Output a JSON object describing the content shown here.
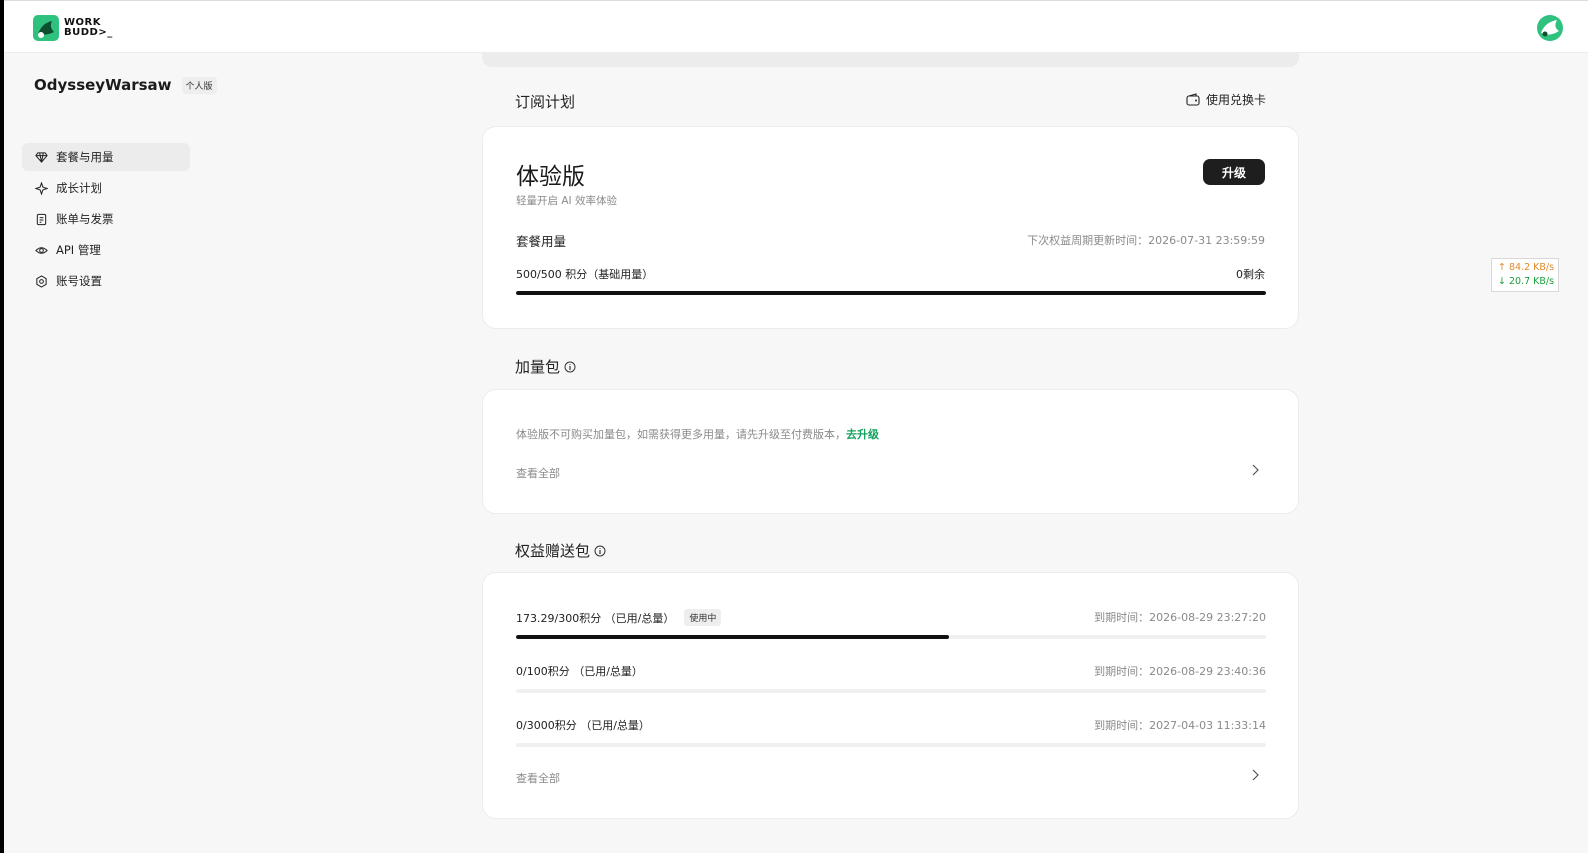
{
  "app": {
    "logo_text_line1": "WORK",
    "logo_text_line2": "BUDD>_"
  },
  "profile": {
    "name": "OdysseyWarsaw",
    "badge": "个人版"
  },
  "sidebar": {
    "items": [
      {
        "label": "套餐与用量",
        "icon": "diamond-icon",
        "active": true
      },
      {
        "label": "成长计划",
        "icon": "sparkle-icon",
        "active": false
      },
      {
        "label": "账单与发票",
        "icon": "receipt-icon",
        "active": false
      },
      {
        "label": "API 管理",
        "icon": "eye-icon",
        "active": false
      },
      {
        "label": "账号设置",
        "icon": "gear-icon",
        "active": false
      }
    ]
  },
  "subscription": {
    "section_title": "订阅计划",
    "redeem_label": "使用兑换卡",
    "plan_name": "体验版",
    "plan_desc": "轻量开启 AI 效率体验",
    "upgrade_label": "升级",
    "usage_title": "套餐用量",
    "renew_text": "下次权益周期更新时间：2026-07-31 23:59:59",
    "usage_amount": "500/500 积分（基础用量）",
    "usage_remain": "0剩余",
    "usage_fraction": 1.0
  },
  "addon": {
    "section_title": "加量包",
    "notice_text": "体验版不可购买加量包，如需获得更多用量，请先升级至付费版本，",
    "notice_link": "去升级",
    "view_all": "查看全部"
  },
  "grants": {
    "section_title": "权益赠送包",
    "in_use_badge": "使用中",
    "rows": [
      {
        "amount": "173.29/300积分 （已用/总量）",
        "expiry": "到期时间：2026-08-29 23:27:20",
        "fraction": 0.5776,
        "in_use": true
      },
      {
        "amount": "0/100积分 （已用/总量）",
        "expiry": "到期时间：2026-08-29 23:40:36",
        "fraction": 0,
        "in_use": false
      },
      {
        "amount": "0/3000积分 （已用/总量）",
        "expiry": "到期时间：2027-04-03 11:33:14",
        "fraction": 0,
        "in_use": false
      }
    ],
    "view_all": "查看全部"
  },
  "network": {
    "up": "↑ 84.2 KB/s",
    "down": "↓ 20.7 KB/s"
  },
  "colors": {
    "accent_green": "#14a35f",
    "bar_fill": "#111111",
    "dark_button": "#1e1e1e"
  }
}
